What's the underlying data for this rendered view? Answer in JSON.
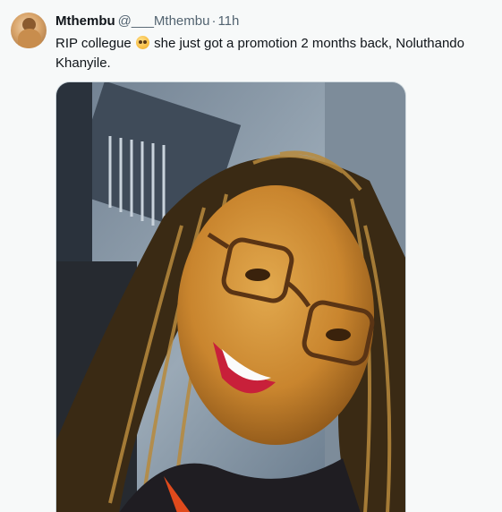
{
  "tweet": {
    "author_name": "Mthembu",
    "author_handle": "@___Mthembu",
    "separator": "·",
    "time": "11h",
    "text_part1": "RIP collegue ",
    "emoji": "pleading-face-emoji",
    "text_part2": " she just got a promotion 2 months back, Noluthando Khanyile.",
    "colors": {
      "background": "#f7f9f9",
      "text": "#0f1419",
      "secondary_text": "#536471",
      "border": "#cfd9de"
    }
  }
}
